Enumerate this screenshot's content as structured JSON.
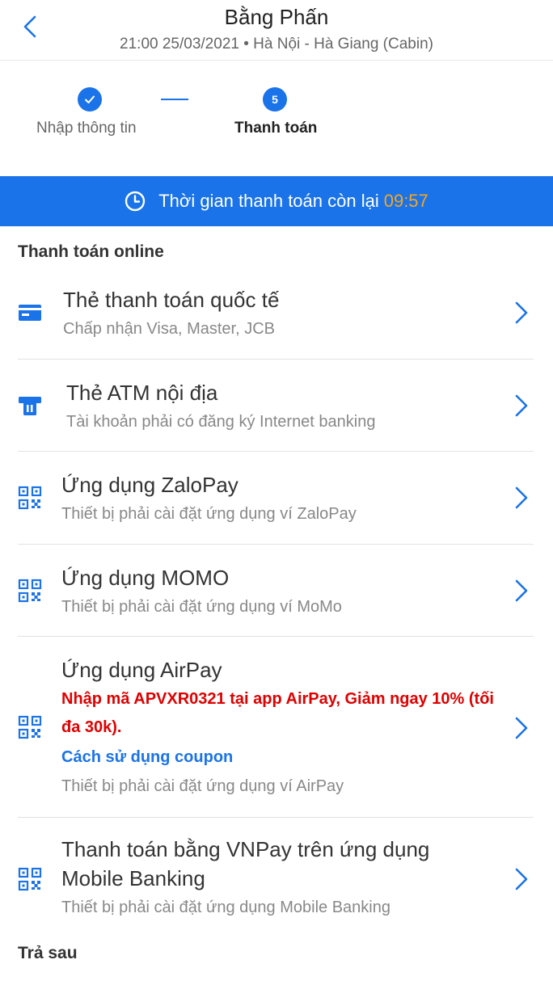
{
  "header": {
    "title": "Bằng Phấn",
    "subtitle": "21:00 25/03/2021 • Hà Nội - Hà Giang (Cabin)"
  },
  "stepper": {
    "steps": [
      {
        "label": "Nhập thông tin",
        "state": "done",
        "icon": "check-icon"
      },
      {
        "label": "Thanh toán",
        "state": "active",
        "number": "5"
      }
    ]
  },
  "timer": {
    "label": "Thời gian thanh toán còn lại",
    "value": "09:57",
    "icon": "clock-icon",
    "accent_color": "#f5a623"
  },
  "sections": {
    "online_title": "Thanh toán online",
    "later_title": "Trả sau"
  },
  "methods": [
    {
      "title": "Thẻ thanh toán quốc tế",
      "desc": "Chấp nhận Visa, Master, JCB",
      "icon": "credit-card-icon"
    },
    {
      "title": "Thẻ ATM nội địa",
      "desc": "Tài khoản phải có đăng ký Internet banking",
      "icon": "atm-icon"
    },
    {
      "title": "Ứng dụng ZaloPay",
      "desc": "Thiết bị phải cài đặt ứng dụng ví ZaloPay",
      "icon": "qr-code-icon"
    },
    {
      "title": "Ứng dụng MOMO",
      "desc": "Thiết bị phải cài đặt ứng dụng ví MoMo",
      "icon": "qr-code-icon"
    },
    {
      "title": "Ứng dụng AirPay",
      "promo": "Nhập mã APVXR0321 tại app AirPay, Giảm ngay 10% (tối đa 30k).",
      "coupon_link": "Cách sử dụng coupon",
      "desc": "Thiết bị phải cài đặt ứng dụng ví AirPay",
      "icon": "qr-code-icon"
    },
    {
      "title_line1": "Thanh toán bằng VNPay trên ứng dụng",
      "title_line2": "Mobile Banking",
      "desc": "Thiết bị phải cài đặt ứng dụng Mobile Banking",
      "icon": "qr-code-icon"
    }
  ],
  "colors": {
    "primary": "#1a73e8",
    "promo_red": "#e00000",
    "timer_accent": "#f5a623"
  }
}
